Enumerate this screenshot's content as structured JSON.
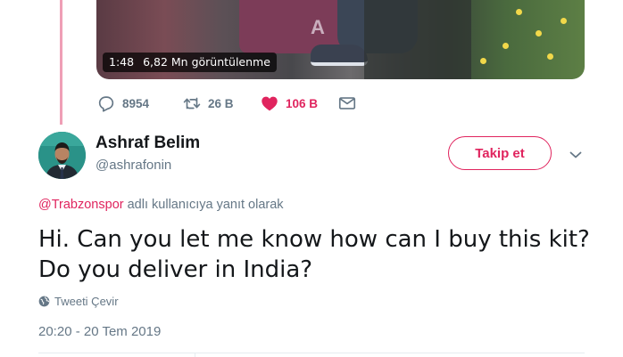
{
  "video": {
    "duration": "1:48",
    "views": "6,82 Mn görüntülenme",
    "shirt_text": "A"
  },
  "actions": {
    "replies": "8954",
    "retweets": "26 B",
    "likes": "106 B"
  },
  "author": {
    "name": "Ashraf Belim",
    "handle": "@ashrafonin"
  },
  "follow": {
    "label": "Takip et"
  },
  "reply_context": {
    "mention": "@Trabzonspor",
    "suffix": " adlı kullanıcıya yanıt olarak"
  },
  "tweet": {
    "text": "Hi. Can you let me know how can I buy this kit? Do you deliver in India?"
  },
  "translate": {
    "label": "Tweeti Çevir"
  },
  "timestamp": "20:20 - 20 Tem 2019",
  "colors": {
    "accent": "#e0245e",
    "secondary_text": "#657786",
    "thread_line": "#ef9fb6"
  },
  "icons": {
    "reply": "reply-icon",
    "retweet": "retweet-icon",
    "like": "heart-icon",
    "message": "envelope-icon",
    "more": "chevron-down-icon",
    "translate": "globe-icon"
  }
}
